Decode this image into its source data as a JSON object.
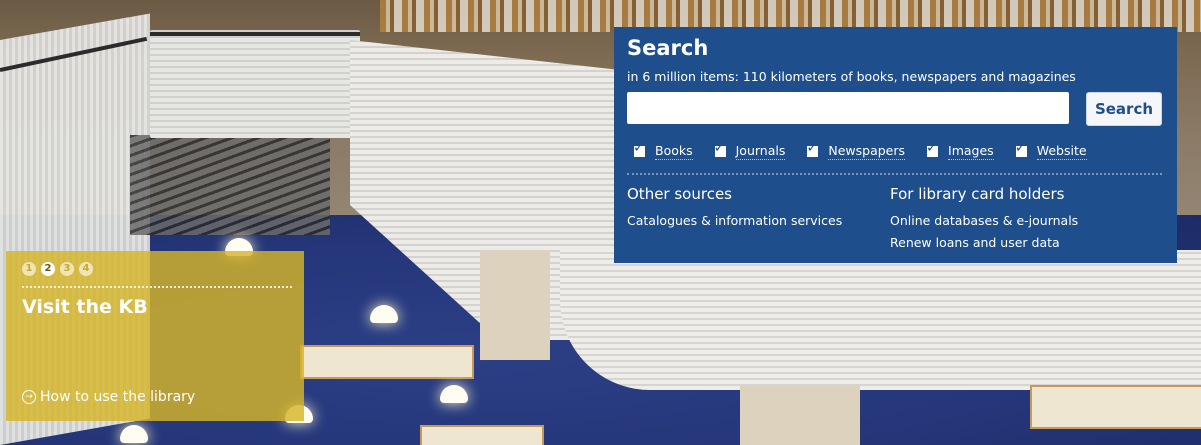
{
  "search": {
    "title": "Search",
    "subtitle": "in 6 million items: 110 kilometers of books, newspapers and magazines",
    "input_value": "",
    "input_placeholder": "",
    "button_label": "Search",
    "filters": [
      {
        "label": "Books",
        "checked": true
      },
      {
        "label": "Journals",
        "checked": true
      },
      {
        "label": "Newspapers",
        "checked": true
      },
      {
        "label": "Images",
        "checked": true
      },
      {
        "label": "Website",
        "checked": true
      }
    ],
    "other_sources": {
      "title": "Other sources",
      "links": [
        "Catalogues & information services"
      ]
    },
    "card_holders": {
      "title": "For library card holders",
      "links": [
        "Online databases & e-journals",
        "Renew loans and user data"
      ]
    }
  },
  "promo": {
    "slides": [
      "1",
      "2",
      "3",
      "4"
    ],
    "active_slide": 2,
    "title": "Visit the KB",
    "link": "How to use the library"
  },
  "colors": {
    "panel_bg": "#1f4e8d",
    "promo_bg": "#d6b428",
    "floor": "#25367a"
  }
}
